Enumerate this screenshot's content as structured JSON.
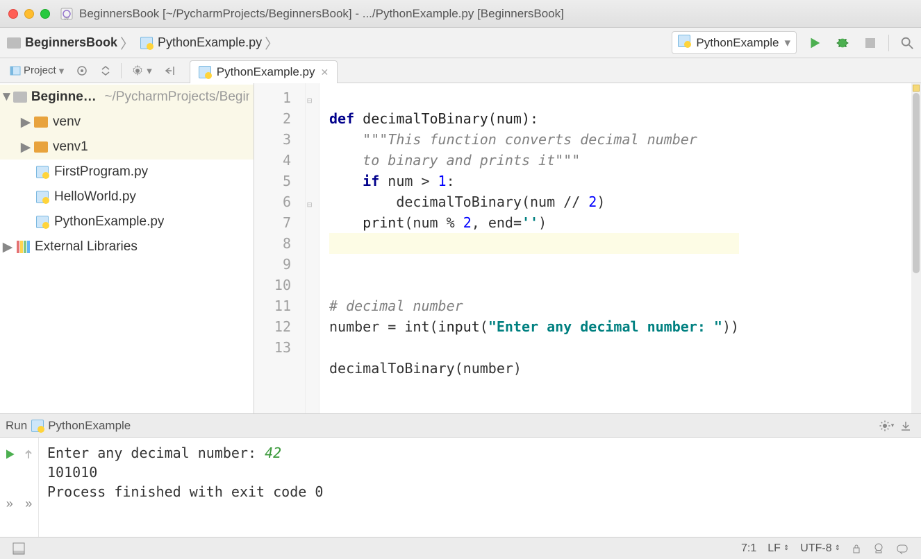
{
  "window": {
    "title": "BeginnersBook [~/PycharmProjects/BeginnersBook] - .../PythonExample.py [BeginnersBook]"
  },
  "breadcrumbs": {
    "project": "BeginnersBook",
    "file": "PythonExample.py"
  },
  "run_config": {
    "name": "PythonExample"
  },
  "toolbar2": {
    "project_label": "Project"
  },
  "editor_tab": {
    "label": "PythonExample.py"
  },
  "tree": {
    "root_name": "BeginnersBook",
    "root_path": "~/PycharmProjects/BeginnersBook",
    "items": [
      {
        "name": "venv",
        "kind": "dir"
      },
      {
        "name": "venv1",
        "kind": "dir"
      },
      {
        "name": "FirstProgram.py",
        "kind": "py"
      },
      {
        "name": "HelloWorld.py",
        "kind": "py"
      },
      {
        "name": "PythonExample.py",
        "kind": "py"
      }
    ],
    "external": "External Libraries"
  },
  "code": {
    "l1_def": "def ",
    "l1_name": "decimalToBinary(num):",
    "l2": "\"\"\"This function converts decimal number",
    "l3": "to binary and prints it\"\"\"",
    "l4_if": "if ",
    "l4_rest": "num > ",
    "l4_num": "1",
    "l4_colon": ":",
    "l5": "decimalToBinary(num // ",
    "l5_num": "2",
    "l5_end": ")",
    "l6_print": "print",
    "l6_open": "(num % ",
    "l6_num": "2",
    "l6_end": ", end=",
    "l6_str": "''",
    "l6_close": ")",
    "l9": "# decimal number",
    "l10_a": "number = ",
    "l10_int": "int",
    "l10_b": "(",
    "l10_inp": "input",
    "l10_c": "(",
    "l10_str": "\"Enter any decimal number: \"",
    "l10_d": "))",
    "l12": "decimalToBinary(number)"
  },
  "line_numbers": [
    "1",
    "2",
    "3",
    "4",
    "5",
    "6",
    "7",
    "8",
    "9",
    "10",
    "11",
    "12",
    "13"
  ],
  "run": {
    "title_prefix": "Run",
    "title_name": "PythonExample",
    "out_prompt": "Enter any decimal number: ",
    "out_input": "42",
    "out_result": "101010",
    "out_exit": "Process finished with exit code 0"
  },
  "status": {
    "pos": "7:1",
    "le": "LF",
    "enc": "UTF-8"
  }
}
